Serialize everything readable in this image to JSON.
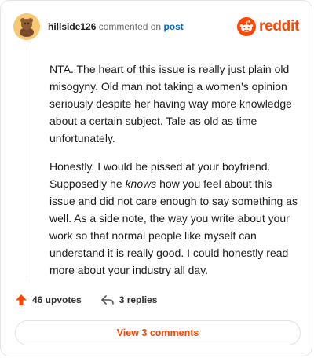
{
  "header": {
    "username": "hillside126",
    "commented_on": "commented on",
    "post_link": "post",
    "brand": "reddit"
  },
  "comment": {
    "paragraph1": "NTA. The heart of this issue is really just plain old misogyny. Old man not taking a women's opinion seriously despite her having way more knowledge about a certain subject. Tale as old as time unfortunately.",
    "paragraph2_before": "Honestly, I would be pissed at your boyfriend. Supposedly he ",
    "paragraph2_emphasis": "knows",
    "paragraph2_after": " how you feel about this issue and did not care enough to say something as well. As a side note, the way you write about your work so that normal people like myself can understand it is really good. I could honestly read more about your industry all day."
  },
  "actions": {
    "upvotes": "46 upvotes",
    "replies": "3 replies"
  },
  "footer": {
    "view_comments": "View 3 comments"
  },
  "colors": {
    "brand": "#ff4500",
    "link": "#0066cc"
  },
  "icons": [
    "avatar-image",
    "reddit-logo-icon",
    "upvote-arrow-icon",
    "reply-arrow-icon"
  ]
}
